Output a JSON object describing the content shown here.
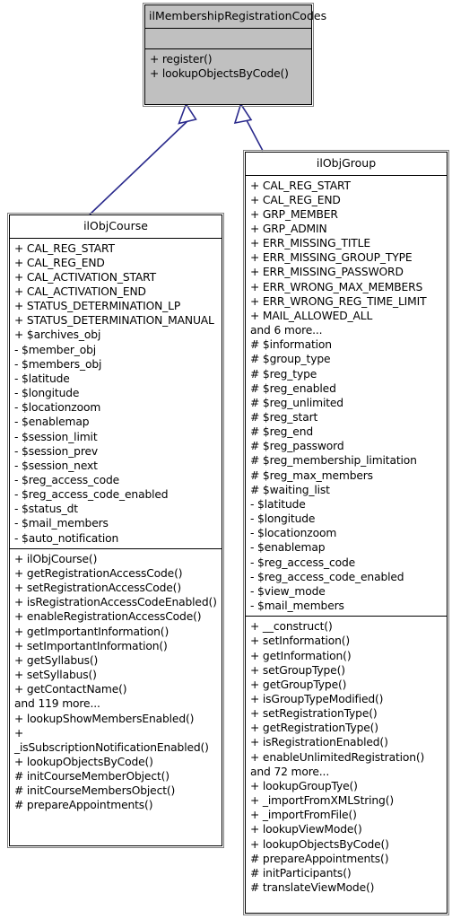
{
  "diagram": {
    "type": "uml-class-diagram",
    "accent_color": "#2a2a8c",
    "base_fill": "#c0c0c0",
    "classes": [
      {
        "id": "ilMembershipRegistrationCodes",
        "name": "ilMembershipRegistrationCodes",
        "role": "base-interface",
        "attributes": [],
        "methods": [
          "+ register()",
          "+ lookupObjectsByCode()"
        ]
      },
      {
        "id": "ilObjCourse",
        "name": "ilObjCourse",
        "role": "derived",
        "attributes": [
          "+ CAL_REG_START",
          "+ CAL_REG_END",
          "+ CAL_ACTIVATION_START",
          "+ CAL_ACTIVATION_END",
          "+ STATUS_DETERMINATION_LP",
          "+ STATUS_DETERMINATION_MANUAL",
          "+ $archives_obj",
          "- $member_obj",
          "- $members_obj",
          "- $latitude",
          "- $longitude",
          "- $locationzoom",
          "- $enablemap",
          "- $session_limit",
          "- $session_prev",
          "- $session_next",
          "- $reg_access_code",
          "- $reg_access_code_enabled",
          "- $status_dt",
          "- $mail_members",
          "- $auto_notification"
        ],
        "methods": [
          "+ ilObjCourse()",
          "+ getRegistrationAccessCode()",
          "+ setRegistrationAccessCode()",
          "+ isRegistrationAccessCodeEnabled()",
          "+ enableRegistrationAccessCode()",
          "+ getImportantInformation()",
          "+ setImportantInformation()",
          "+ getSyllabus()",
          "+ setSyllabus()",
          "+ getContactName()",
          "and 119 more...",
          "+ lookupShowMembersEnabled()",
          "+ _isSubscriptionNotificationEnabled()",
          "+ lookupObjectsByCode()",
          "# initCourseMemberObject()",
          "# initCourseMembersObject()",
          "# prepareAppointments()"
        ]
      },
      {
        "id": "ilObjGroup",
        "name": "ilObjGroup",
        "role": "derived",
        "attributes": [
          "+ CAL_REG_START",
          "+ CAL_REG_END",
          "+ GRP_MEMBER",
          "+ GRP_ADMIN",
          "+ ERR_MISSING_TITLE",
          "+ ERR_MISSING_GROUP_TYPE",
          "+ ERR_MISSING_PASSWORD",
          "+ ERR_WRONG_MAX_MEMBERS",
          "+ ERR_WRONG_REG_TIME_LIMIT",
          "+ MAIL_ALLOWED_ALL",
          "and 6 more...",
          "# $information",
          "# $group_type",
          "# $reg_type",
          "# $reg_enabled",
          "# $reg_unlimited",
          "# $reg_start",
          "# $reg_end",
          "# $reg_password",
          "# $reg_membership_limitation",
          "# $reg_max_members",
          "# $waiting_list",
          "- $latitude",
          "- $longitude",
          "- $locationzoom",
          "- $enablemap",
          "- $reg_access_code",
          "- $reg_access_code_enabled",
          "- $view_mode",
          "- $mail_members"
        ],
        "methods": [
          "+ __construct()",
          "+ setInformation()",
          "+ getInformation()",
          "+ setGroupType()",
          "+ getGroupType()",
          "+ isGroupTypeModified()",
          "+ setRegistrationType()",
          "+ getRegistrationType()",
          "+ isRegistrationEnabled()",
          "+ enableUnlimitedRegistration()",
          "and 72 more...",
          "+ lookupGroupTye()",
          "+ _importFromXMLString()",
          "+ _importFromFile()",
          "+ lookupViewMode()",
          "+ lookupObjectsByCode()",
          "# prepareAppointments()",
          "# initParticipants()",
          "# translateViewMode()"
        ]
      }
    ],
    "relations": [
      {
        "from": "ilObjCourse",
        "to": "ilMembershipRegistrationCodes",
        "kind": "generalization"
      },
      {
        "from": "ilObjGroup",
        "to": "ilMembershipRegistrationCodes",
        "kind": "generalization"
      }
    ]
  }
}
